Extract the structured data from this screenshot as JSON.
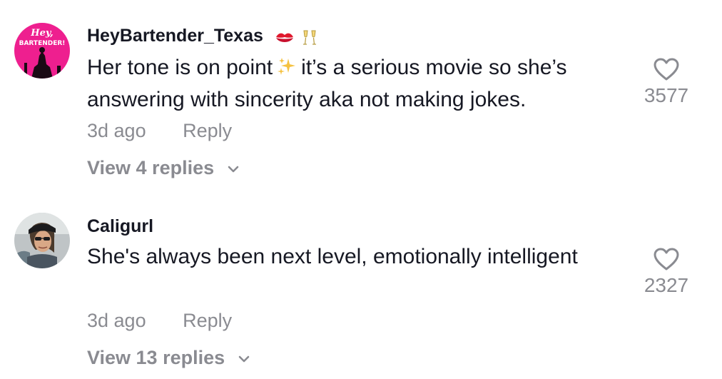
{
  "comments": [
    {
      "username": "HeyBartender_Texas",
      "avatar_text_1": "Hey,",
      "avatar_text_2": "BARTENDER!",
      "avatar_color": "#ee1f8f",
      "text_before": "Her tone is on point",
      "text_after": "it’s a serious movie so she’s answering with sincerity aka not making jokes.",
      "timestamp": "3d ago",
      "reply_label": "Reply",
      "view_replies_label": "View 4 replies",
      "like_count": "3577",
      "emojis": [
        "kiss-mark-icon",
        "champagne-glasses-icon"
      ]
    },
    {
      "username": "Caligurl",
      "text": "She's always been next level, emotionally intelligent",
      "timestamp": "3d ago",
      "reply_label": "Reply",
      "view_replies_label": "View 13 replies",
      "like_count": "2327"
    }
  ],
  "colors": {
    "primary_text": "#161823",
    "secondary_text": "#8a8b91",
    "sparkle": "#f5c242"
  }
}
